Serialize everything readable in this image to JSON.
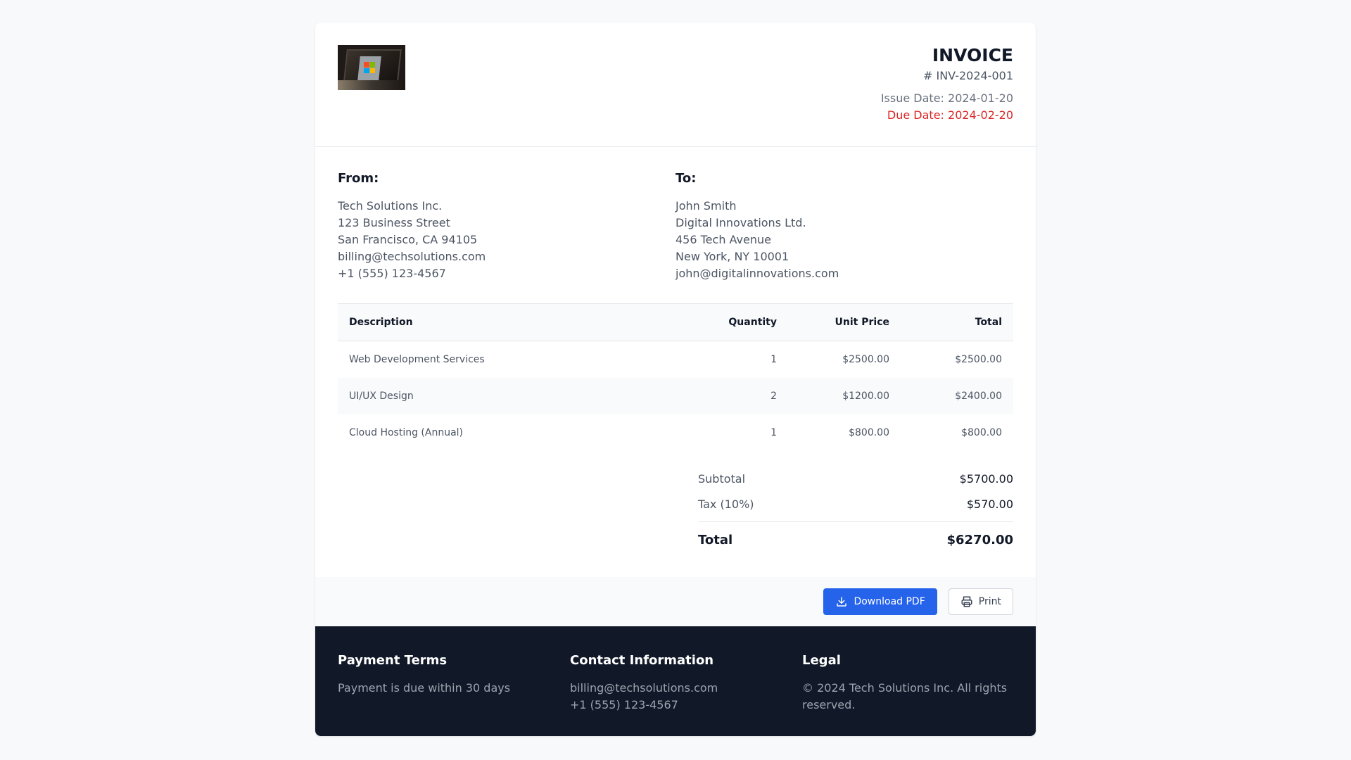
{
  "invoice": {
    "title": "INVOICE",
    "number": "# INV-2024-001",
    "issue_date": "Issue Date: 2024-01-20",
    "due_date": "Due Date: 2024-02-20"
  },
  "from": {
    "heading": "From:",
    "lines": [
      "Tech Solutions Inc.",
      "123 Business Street",
      "San Francisco, CA 94105",
      "billing@techsolutions.com",
      "+1 (555) 123-4567"
    ]
  },
  "to": {
    "heading": "To:",
    "lines": [
      "John Smith",
      "Digital Innovations Ltd.",
      "456 Tech Avenue",
      "New York, NY 10001",
      "john@digitalinnovations.com"
    ]
  },
  "table": {
    "headers": [
      "Description",
      "Quantity",
      "Unit Price",
      "Total"
    ],
    "rows": [
      [
        "Web Development Services",
        "1",
        "$2500.00",
        "$2500.00"
      ],
      [
        "UI/UX Design",
        "2",
        "$1200.00",
        "$2400.00"
      ],
      [
        "Cloud Hosting (Annual)",
        "1",
        "$800.00",
        "$800.00"
      ]
    ]
  },
  "totals": {
    "subtotal_label": "Subtotal",
    "subtotal": "$5700.00",
    "tax_label": "Tax (10%)",
    "tax": "$570.00",
    "total_label": "Total",
    "total": "$6270.00"
  },
  "actions": {
    "download_label": "Download PDF",
    "print_label": "Print"
  },
  "footer": {
    "payment_heading": "Payment Terms",
    "payment_text": "Payment is due within 30 days",
    "contact_heading": "Contact Information",
    "contact_email": "billing@techsolutions.com",
    "contact_phone": "+1 (555) 123-4567",
    "legal_heading": "Legal",
    "legal_text": "© 2024 Tech Solutions Inc. All rights reserved."
  },
  "colors": {
    "accent": "#2563eb",
    "due": "#dc2626",
    "footer_bg": "#111827"
  }
}
